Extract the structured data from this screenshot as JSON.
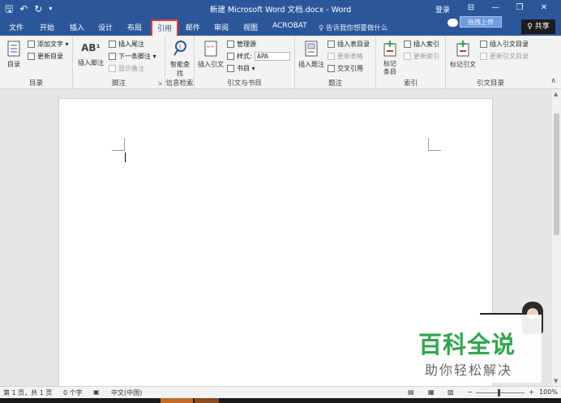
{
  "window": {
    "title": "新建 Microsoft Word 文档.docx  -  Word",
    "login": "登录",
    "qat": {
      "save": "🖫",
      "undo": "↶",
      "redo": "↻",
      "more": "▾"
    },
    "controls": {
      "ribbon_display": "⊟",
      "minimize": "—",
      "restore": "❐",
      "close": "✕"
    }
  },
  "tabs": [
    {
      "label": "文件"
    },
    {
      "label": "开始"
    },
    {
      "label": "插入"
    },
    {
      "label": "设计"
    },
    {
      "label": "布局"
    },
    {
      "label": "引用"
    },
    {
      "label": "邮件"
    },
    {
      "label": "审阅"
    },
    {
      "label": "视图"
    },
    {
      "label": "ACROBAT"
    }
  ],
  "tell_me": "♀ 告诉我你想要做什么",
  "upload_label": "拖拽上传",
  "share_label": "♀ 共享",
  "ribbon": {
    "toc": {
      "group_label": "目录",
      "big": "目录",
      "add_text": "添加文字 ▾",
      "update_toc": "更新目录"
    },
    "footnotes": {
      "group_label": "脚注",
      "insert_footnote": "插入脚注",
      "insert_endnote": "插入尾注",
      "next_footnote": "下一条脚注 ▾",
      "show_notes": "显示备注",
      "ab_glyph": "AB¹"
    },
    "research": {
      "group_label": "信息检索",
      "smart_lookup": "智能查找"
    },
    "citations": {
      "group_label": "引文与书目",
      "insert_citation": "插入引文",
      "manage_sources": "管理源",
      "style_label": "样式:",
      "style_value": "APA",
      "bibliography": "书目 ▾"
    },
    "captions": {
      "group_label": "题注",
      "insert_caption": "插入题注",
      "insert_table_of_figures": "插入表目录",
      "update_table": "更新表格",
      "cross_reference": "交叉引用"
    },
    "index": {
      "group_label": "索引",
      "mark_entry": "标记条目",
      "insert_index": "插入索引",
      "update_index": "更新索引"
    },
    "table_of_authorities": {
      "group_label": "引文目录",
      "mark_citation": "标记引文",
      "insert_toa": "插入引文目录",
      "update_toa": "更新引文目录"
    }
  },
  "statusbar": {
    "page": "第 1 页，共 1 页",
    "words": "0 个字",
    "language": "中文(中国)",
    "zoom": "100%",
    "zoom_minus": "−",
    "zoom_plus": "+"
  },
  "watermark": {
    "title": "百科全说",
    "subtitle": "助你轻松解决"
  }
}
